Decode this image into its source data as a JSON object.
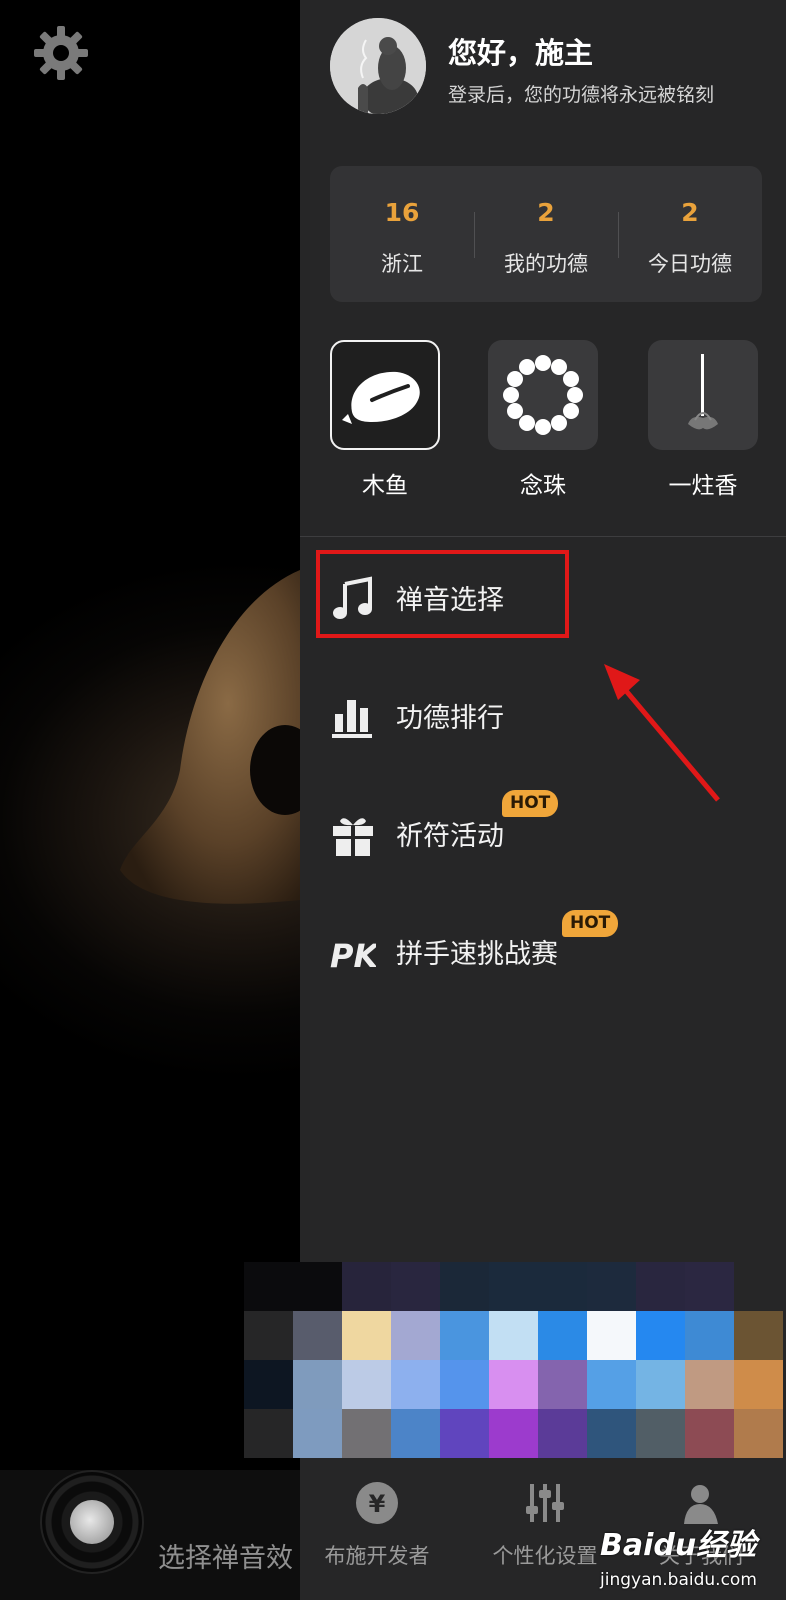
{
  "user": {
    "greeting": "您好，施主",
    "subtitle": "登录后，您的功德将永远被铭刻"
  },
  "stats": [
    {
      "value": "16",
      "label": "浙江"
    },
    {
      "value": "2",
      "label": "我的功德"
    },
    {
      "value": "2",
      "label": "今日功德"
    }
  ],
  "tools": [
    {
      "label": "木鱼",
      "selected": true,
      "icon": "wooden-fish-icon"
    },
    {
      "label": "念珠",
      "selected": false,
      "icon": "prayer-beads-icon"
    },
    {
      "label": "一炷香",
      "selected": false,
      "icon": "incense-icon"
    }
  ],
  "menu": [
    {
      "label": "禅音选择",
      "icon": "music-note-icon",
      "badge": ""
    },
    {
      "label": "功德排行",
      "icon": "ranking-chart-icon",
      "badge": ""
    },
    {
      "label": "祈符活动",
      "icon": "gift-icon",
      "badge": "HOT"
    },
    {
      "label": "拼手速挑战赛",
      "icon": "pk-icon",
      "badge": "HOT"
    }
  ],
  "bottom_nav": [
    {
      "label": "布施开发者",
      "icon": "yen-coin-icon"
    },
    {
      "label": "个性化设置",
      "icon": "sliders-icon"
    },
    {
      "label": "关于我们",
      "icon": "monk-icon"
    }
  ],
  "player": {
    "label": "选择禅音效"
  },
  "watermark": {
    "logo": "Baidu经验",
    "url": "jingyan.baidu.com"
  },
  "colors": {
    "accent": "#e9a23b",
    "drawer_bg": "#262627",
    "highlight": "#e01818",
    "hot_badge": "#f0a63a"
  }
}
